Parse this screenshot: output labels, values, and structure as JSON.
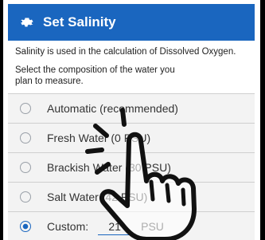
{
  "dialog": {
    "title": "Set Salinity",
    "icon": "gear-icon"
  },
  "description": {
    "line1": "Salinity is used in the calculation of Dissolved Oxygen.",
    "line2": "Select the composition of the water you plan to measure."
  },
  "options": [
    {
      "label": "Automatic (recommended)",
      "selected": false
    },
    {
      "label": "Fresh Water (0 PSU)",
      "selected": false
    },
    {
      "label": "Brackish Water (30 PSU)",
      "selected": false
    },
    {
      "label": "Salt Water (42 PSU)",
      "selected": false
    }
  ],
  "custom": {
    "label": "Custom:",
    "value": "21",
    "unit": "PSU",
    "selected": true
  },
  "colors": {
    "accent": "#1a66bf",
    "option_bg": "#f3f3f3"
  },
  "overlay": {
    "icon": "tap-hand-icon"
  }
}
